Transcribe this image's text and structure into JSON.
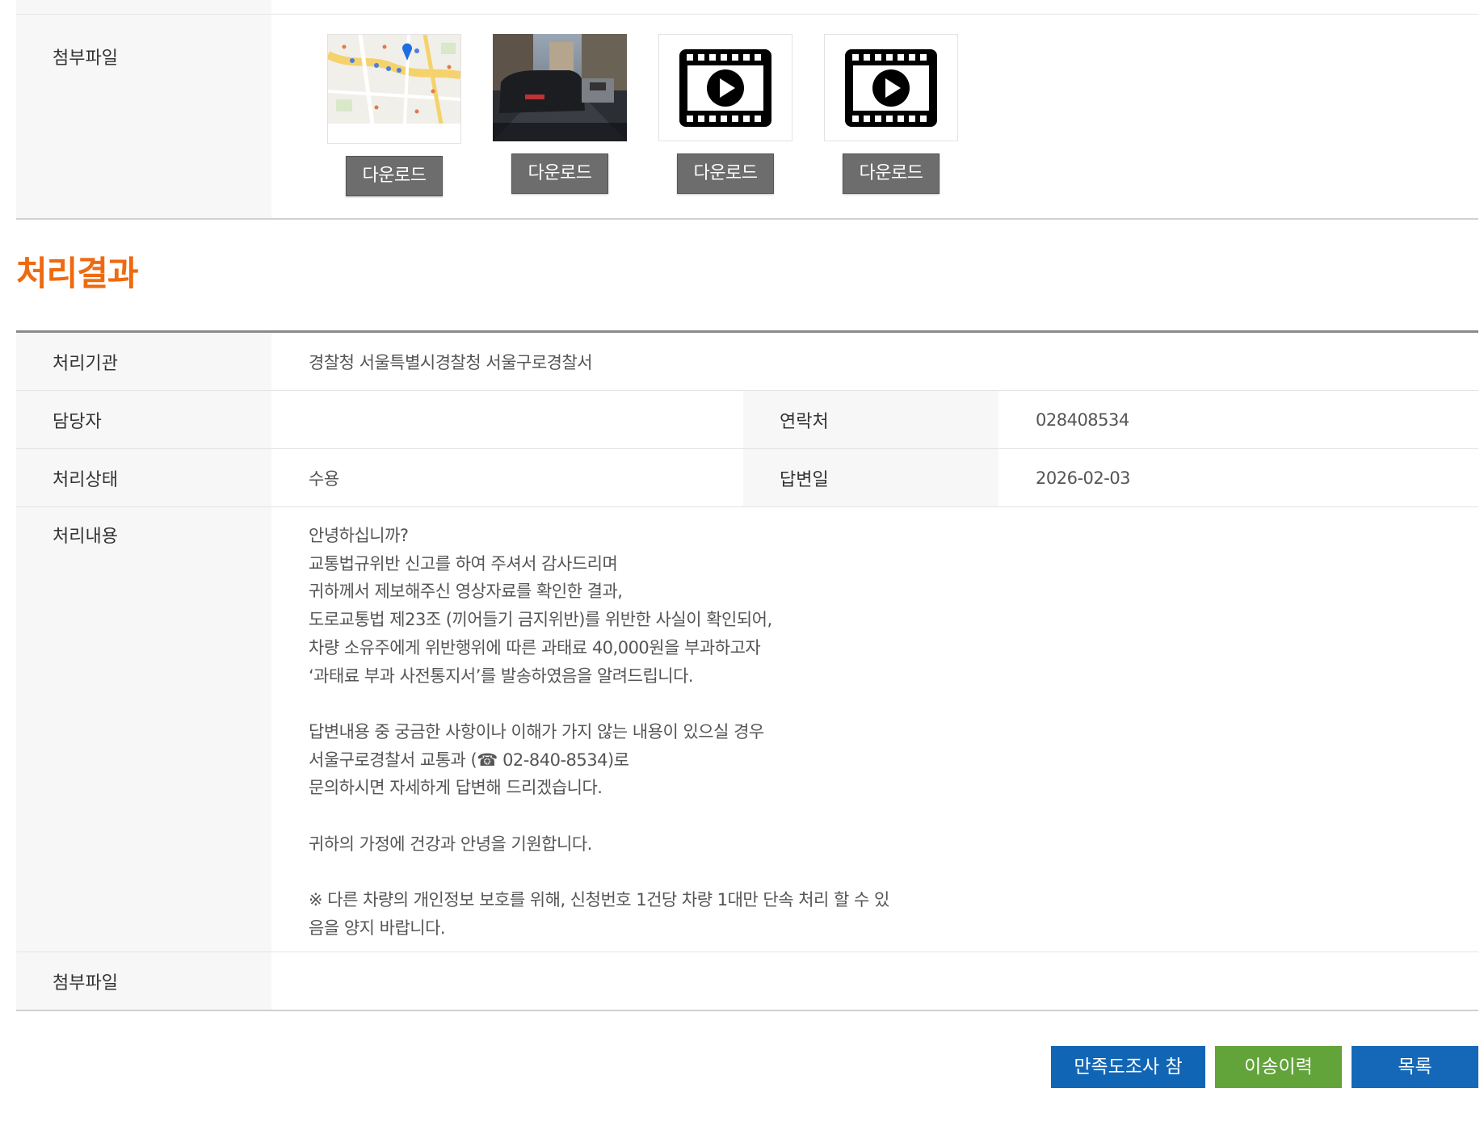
{
  "attachments_top": {
    "label": "첨부파일",
    "items": [
      {
        "type": "map-image",
        "download_label": "다운로드"
      },
      {
        "type": "photo-image",
        "download_label": "다운로드"
      },
      {
        "type": "video",
        "icon": "video-file-icon",
        "download_label": "다운로드"
      },
      {
        "type": "video",
        "icon": "video-file-icon",
        "download_label": "다운로드"
      }
    ]
  },
  "section_title": "처리결과",
  "result": {
    "agency_label": "처리기관",
    "agency_value": "경찰청 서울특별시경찰청 서울구로경찰서",
    "manager_label": "담당자",
    "manager_value": "",
    "contact_label": "연락처",
    "contact_value": "028408534",
    "status_label": "처리상태",
    "status_value": "수용",
    "answer_date_label": "답변일",
    "answer_date_value": "2026-02-03",
    "content_label": "처리내용",
    "content_lines": [
      "안녕하십니까?",
      "교통법규위반 신고를 하여 주셔서 감사드리며",
      "귀하께서 제보해주신 영상자료를 확인한 결과,",
      "도로교통법 제23조 (끼어들기 금지위반)를 위반한 사실이 확인되어,",
      "차량 소유주에게 위반행위에 따른 과태료 40,000원을 부과하고자",
      "‘과태료 부과 사전통지서’를 발송하였음을 알려드립니다.",
      "",
      "답변내용 중 궁금한 사항이나 이해가 가지 않는 내용이 있으실 경우",
      "서울구로경찰서 교통과 (☎ 02-840-8534)로",
      "문의하시면 자세하게 답변해 드리겠습니다.",
      "",
      "귀하의 가정에 건강과 안녕을 기원합니다.",
      "",
      "※ 다른 차량의 개인정보 보호를 위해, 신청번호 1건당 차량 1대만 단속 처리 할 수 있",
      "음을 양지 바랍니다."
    ],
    "attach_label": "첨부파일"
  },
  "buttons": {
    "survey": "만족도조사 참여",
    "history": "이송이력",
    "list": "목록"
  },
  "colors": {
    "section_title": "#ee6a10",
    "download_button": "#6d6d6d",
    "survey_button": "#1165b5",
    "history_button": "#62a33a",
    "list_button": "#1468b7"
  }
}
